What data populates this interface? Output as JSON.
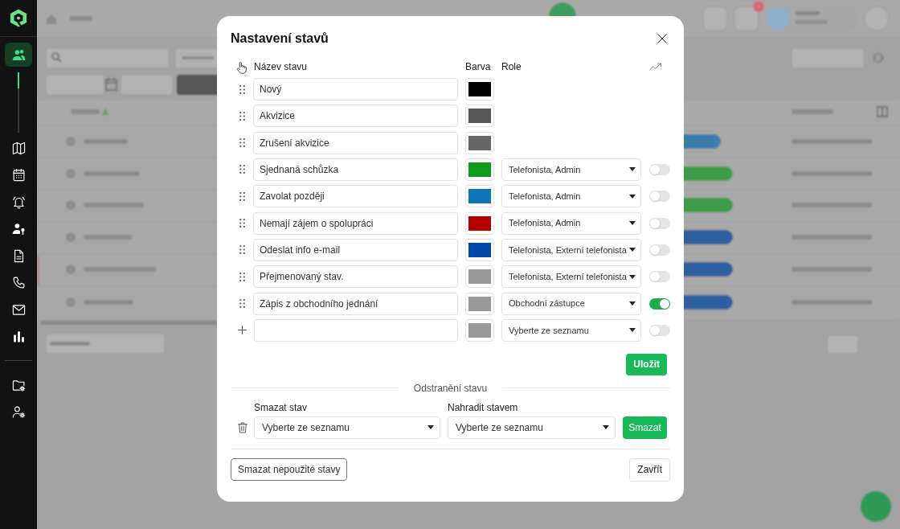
{
  "sidebar": {
    "items": [
      {
        "selected": true
      },
      {
        "selected": false
      },
      {
        "selected": false
      },
      {
        "selected": false
      },
      {
        "selected": false
      },
      {
        "selected": false
      },
      {
        "selected": false
      },
      {
        "selected": false
      },
      {
        "selected": false
      }
    ],
    "admin_items": [
      {
        "selected": false
      },
      {
        "selected": false
      }
    ]
  },
  "dialog": {
    "title": "Nastavení stavů",
    "columns": [
      "Název stavu",
      "Barva",
      "Role"
    ],
    "states": [
      {
        "kind": "fixed",
        "name": "Nový",
        "color": "#000000"
      },
      {
        "kind": "fixed",
        "name": "Akvizice",
        "color": "#555555"
      },
      {
        "kind": "fixed",
        "name": "Zrušení akvizice",
        "color": "#666666"
      },
      {
        "kind": "custom",
        "name": "Sjednaná schůzka",
        "color": "#0f9a1c",
        "role": "Telefonista, Admin",
        "on": false
      },
      {
        "kind": "custom",
        "name": "Zavolat později",
        "color": "#0b76b8",
        "role": "Telefonista, Admin",
        "on": false
      },
      {
        "kind": "custom",
        "name": "Nemají zájem o spolupráci",
        "color": "#b30000",
        "role": "Telefonista, Admin",
        "on": false
      },
      {
        "kind": "custom",
        "name": "Odeslat info e-mail",
        "color": "#0047a8",
        "role": "Telefonista, Externí telefonista",
        "on": false
      },
      {
        "kind": "custom",
        "name": "Přejmenovaný stav.",
        "color": "#999999",
        "role": "Telefonista, Externí telefonista",
        "on": false
      },
      {
        "kind": "custom",
        "name": "Zápis z obchodního jednání",
        "color": "#999999",
        "role": "Obchodní zástupce",
        "on": true
      }
    ],
    "new_state": {
      "color": "#999999",
      "role_placeholder": "Vyberte ze seznamu",
      "on": false
    },
    "save_button": "Uložit",
    "removal": {
      "heading": "Odstranění stavu",
      "delete_label": "Smazat stav",
      "delete_placeholder": "Vyberte ze seznamu",
      "replace_label": "Nahradit stavem",
      "replace_placeholder": "Vyberte ze seznamu",
      "delete_button": "Smazat"
    },
    "footer": {
      "cleanup_button": "Smazat nepoužité stavy",
      "close_button": "Zavřít"
    }
  }
}
